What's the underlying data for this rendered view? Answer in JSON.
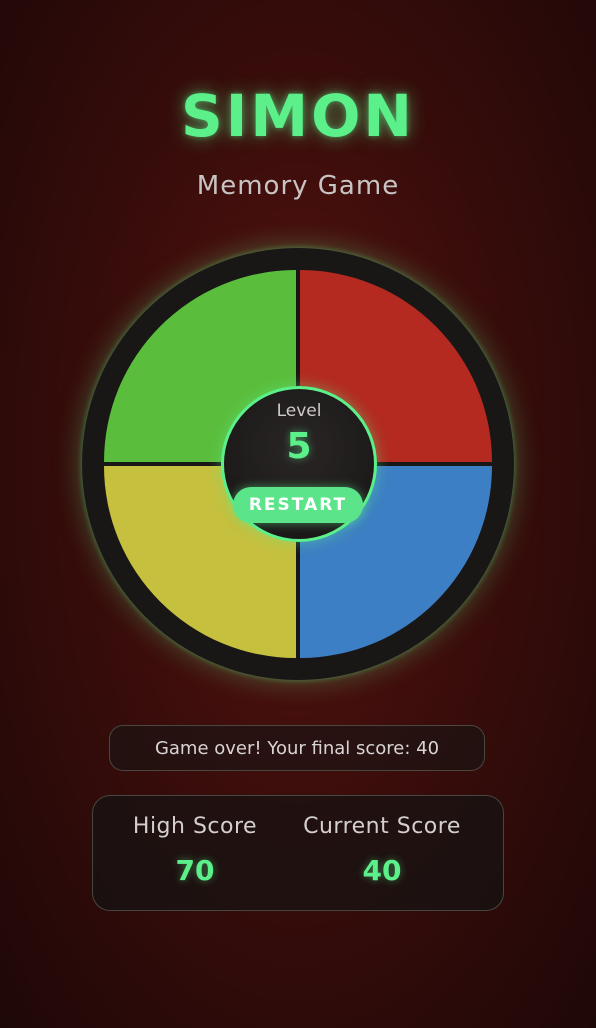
{
  "header": {
    "title": "SIMON",
    "subtitle": "Memory Game"
  },
  "board": {
    "pads": [
      {
        "name": "green",
        "color": "#5bbd3c"
      },
      {
        "name": "red",
        "color": "#b42a20"
      },
      {
        "name": "yellow",
        "color": "#c6c03f"
      },
      {
        "name": "blue",
        "color": "#3d7fc4"
      }
    ],
    "center": {
      "level_label": "Level",
      "level_value": "5",
      "restart_label": "RESTART"
    }
  },
  "status": {
    "message": "Game over! Your final score: 40"
  },
  "scores": {
    "high_label": "High Score",
    "high_value": "70",
    "current_label": "Current Score",
    "current_value": "40"
  },
  "colors": {
    "accent": "#5cf08a",
    "board": "#191616"
  }
}
